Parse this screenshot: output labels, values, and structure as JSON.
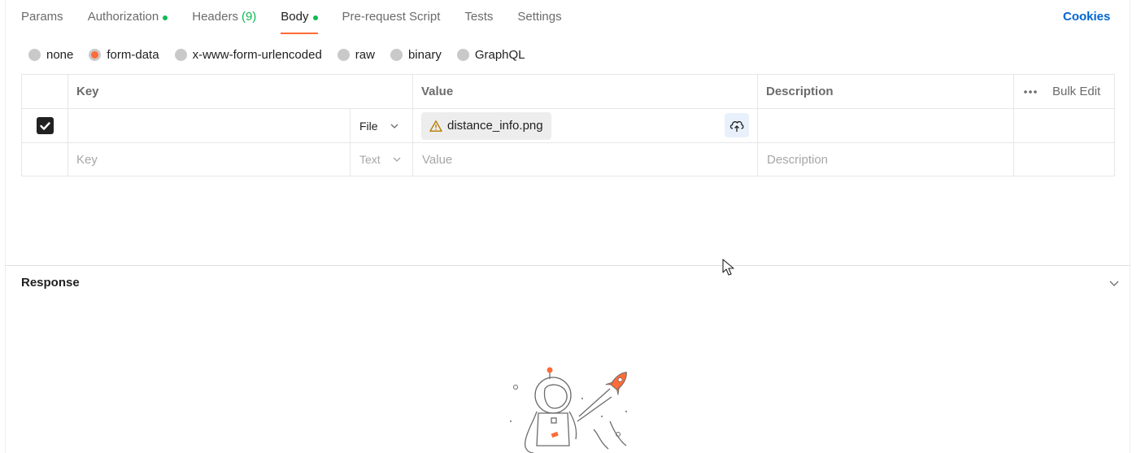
{
  "tabs": [
    {
      "label": "Params"
    },
    {
      "label": "Authorization"
    },
    {
      "label": "Headers",
      "count": "9"
    },
    {
      "label": "Body"
    },
    {
      "label": "Pre-request Script"
    },
    {
      "label": "Tests"
    },
    {
      "label": "Settings"
    }
  ],
  "cookies_label": "Cookies",
  "body_types": [
    "none",
    "form-data",
    "x-www-form-urlencoded",
    "raw",
    "binary",
    "GraphQL"
  ],
  "selected_body_type": "form-data",
  "table": {
    "headers": {
      "key": "Key",
      "value": "Value",
      "description": "Description",
      "bulk_edit": "Bulk Edit"
    },
    "rows": [
      {
        "checked": true,
        "key": "",
        "type": "File",
        "value_file": "distance_info.png",
        "description": ""
      }
    ],
    "new_row": {
      "key_placeholder": "Key",
      "type": "Text",
      "value_placeholder": "Value",
      "description_placeholder": "Description"
    }
  },
  "response": {
    "title": "Response"
  },
  "colors": {
    "accent": "#ff6c37",
    "green": "#0cbb52",
    "link": "#0265d2"
  },
  "icons": [
    "warning-icon",
    "cloud-upload-icon",
    "chevron-down-icon",
    "more-horizontal-icon",
    "check-icon"
  ]
}
